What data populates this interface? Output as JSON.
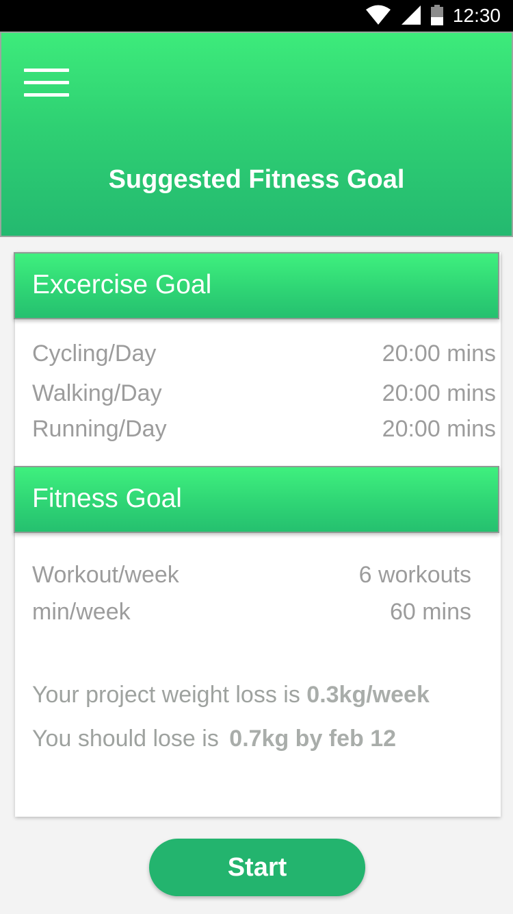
{
  "status_bar": {
    "time": "12:30",
    "icons": [
      "wifi-icon",
      "cell-signal-icon",
      "battery-icon"
    ]
  },
  "header": {
    "menu_icon": "hamburger-menu-icon",
    "title": "Suggested Fitness Goal"
  },
  "exercise_goal": {
    "title": "Excercise Goal",
    "rows": [
      {
        "label": "Cycling/Day",
        "value": "20:00 mins"
      },
      {
        "label": "Walking/Day",
        "value": "20:00 mins"
      },
      {
        "label": "Running/Day",
        "value": "20:00 mins"
      }
    ]
  },
  "fitness_goal": {
    "title": "Fitness Goal",
    "rows": [
      {
        "label": "Workout/week",
        "value": "6 workouts"
      },
      {
        "label": "min/week",
        "value": "60 mins"
      }
    ],
    "weight_loss_text": "Your project weight loss is",
    "weight_loss_value": "0.3kg/week",
    "lose_text": "You should lose is",
    "lose_value": "0.7kg by feb 12"
  },
  "start_button": {
    "label": "Start"
  },
  "colors": {
    "accent": "#2fd173",
    "button": "#23b46e",
    "text_muted": "#9c9c9c"
  }
}
